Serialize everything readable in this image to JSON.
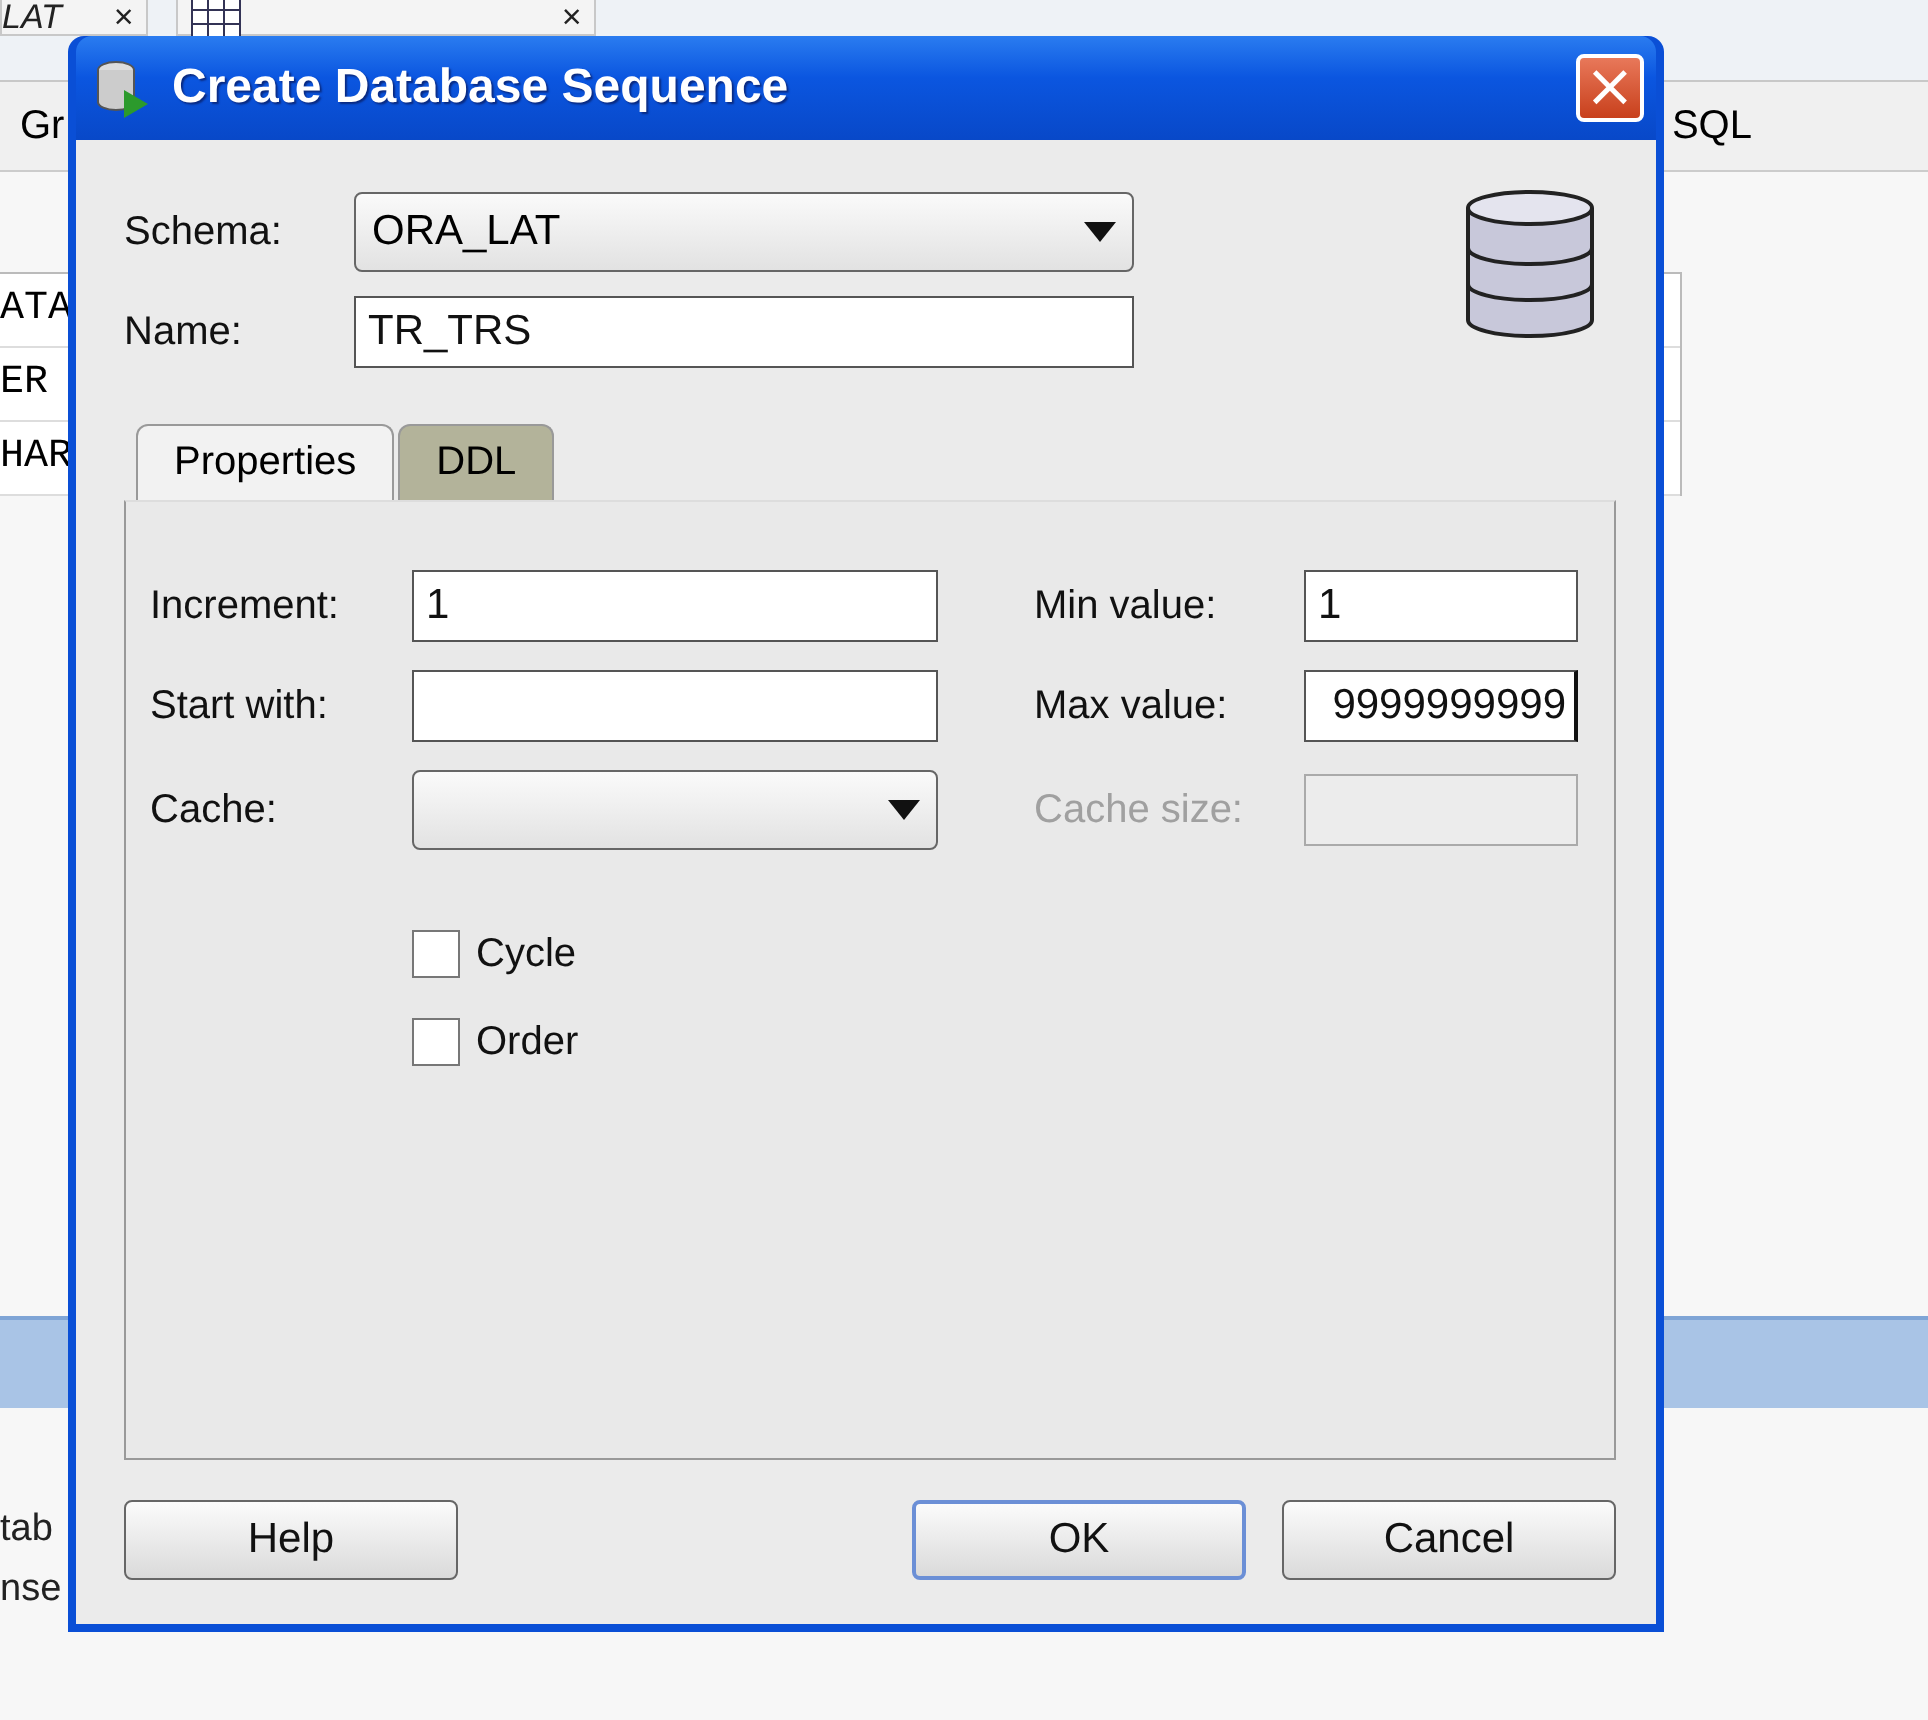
{
  "background": {
    "tabs": [
      {
        "label": "LAT",
        "close": "×",
        "kind": "text"
      },
      {
        "close": "×",
        "kind": "table"
      }
    ],
    "toolbar": [
      "Gr",
      "SQL"
    ],
    "cells": [
      "ATA",
      "ER",
      "HAR"
    ],
    "footer_lines": [
      "tab",
      "nse"
    ]
  },
  "dialog": {
    "title": "Create Database Sequence",
    "close": "×",
    "schema": {
      "label": "Schema:",
      "value": "ORA_LAT"
    },
    "name": {
      "label": "Name:",
      "value": "TR_TRS"
    },
    "tabs": [
      {
        "label": "Properties",
        "selected": true
      },
      {
        "label": "DDL",
        "selected": false
      }
    ],
    "fields": [
      {
        "label": "Increment:",
        "kind": "text",
        "value": "1",
        "disabled": false
      },
      {
        "label": "Min value:",
        "kind": "text",
        "value": "1",
        "disabled": false
      },
      {
        "label": "Start with:",
        "kind": "text",
        "disabled": false
      },
      {
        "label": "Max value:",
        "kind": "text",
        "value": "9999999999",
        "disabled": false,
        "focused": true
      },
      {
        "label": "Cache:",
        "kind": "dropdown",
        "disabled": false
      },
      {
        "label": "Cache size:",
        "kind": "text",
        "disabled": true
      }
    ],
    "checkboxes": [
      {
        "label": "Cycle",
        "checked": false
      },
      {
        "label": "Order",
        "checked": false
      }
    ],
    "buttons": [
      {
        "label": "Help",
        "default": false
      },
      {
        "label": "OK",
        "default": true
      },
      {
        "label": "Cancel",
        "default": false
      }
    ]
  }
}
